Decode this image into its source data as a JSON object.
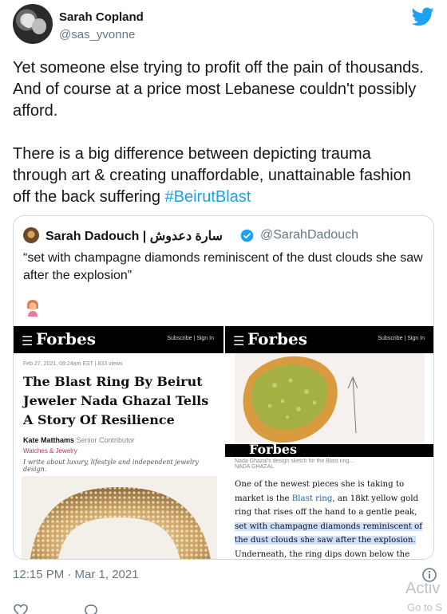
{
  "author": {
    "name": "Sarah Copland",
    "handle": "@sas_yvonne"
  },
  "tweet": {
    "text": "Yet someone else trying to profit off the pain of thousands. And of course at a price most Lebanese couldn't possibly afford.\n\nThere is a big difference between depicting trauma through art & creating unaffordable, unattainable fashion off the back suffering ",
    "hashtag": "#BeirutBlast",
    "timestamp": "12:15 PM · Mar 1, 2021"
  },
  "quoted": {
    "name": "Sarah Dadouch | سارة دعدوش",
    "handle": "@SarahDadouch",
    "text": "“set with champagne diamonds reminiscent of the dust clouds she saw after the explosion”",
    "left_article": {
      "brand": "Forbes",
      "subscribe": "Subscribe | Sign In",
      "meta": "Feb 27, 2021, 09:24am EST  |  833 views",
      "title": "The Blast Ring By Beirut Jeweler Nada Ghazal Tells A Story Of Resilience",
      "author_name": "Kate Matthams",
      "author_role": "Senior Contributor",
      "category": "Watches & Jewelry",
      "bio": "I write about luxury, lifestyle and independent jewelry design."
    },
    "right_article": {
      "brand": "Forbes",
      "subscribe": "Subscribe | Sign In",
      "caption": "Nada Ghazal's design sketch for the Blast ring…",
      "caption_credit": "NADA GHAZAL",
      "body_1": "One of the newest pieces she is taking to market is the ",
      "body_link": "Blast ring",
      "body_2": ", an 18kt yellow gold ring that rises off the hand to a gentle peak, ",
      "body_hl": "set with champagne diamonds reminiscent of the dust clouds she saw after the explosion.",
      "body_3": " Underneath, the ring dips down below the finger, symbolizing"
    }
  },
  "overlay": {
    "line1": "Activ",
    "line2": "Go to S"
  },
  "colors": {
    "accent": "#1da1f2",
    "muted": "#657786",
    "border": "#cfd9de"
  }
}
